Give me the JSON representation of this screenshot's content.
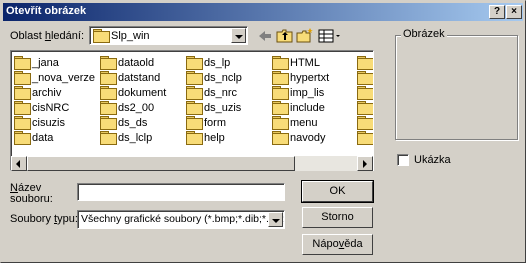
{
  "window": {
    "title": "Otevřít obrázek",
    "help_button": "?",
    "close_button": "×"
  },
  "lookin": {
    "label_prefix": "Oblast ",
    "label_underlined": "h",
    "label_suffix": "ledání:",
    "value": "Slp_win"
  },
  "toolbar": {
    "icons": [
      "back-icon",
      "up-folder-icon",
      "new-folder-icon",
      "view-menu-icon"
    ]
  },
  "files": {
    "columns": [
      [
        "_jana",
        "_nova_verze",
        "archiv",
        "cisNRC",
        "cisuzis",
        "data"
      ],
      [
        "dataold",
        "datstand",
        "dokument",
        "ds2_00",
        "ds_ds",
        "ds_lclp"
      ],
      [
        "ds_lp",
        "ds_nclp",
        "ds_nrc",
        "ds_uzis",
        "form",
        "help"
      ],
      [
        "HTML",
        "hypertxt",
        "imp_lis",
        "include",
        "menu",
        "navody"
      ],
      [
        "p",
        "p",
        "r",
        "r",
        "s",
        "t"
      ]
    ]
  },
  "filename": {
    "label_underlined": "N",
    "label_rest_line1": "ázev",
    "label_line2": "souboru:",
    "value": ""
  },
  "filetype": {
    "label_prefix": "Soubory ",
    "label_underlined": "t",
    "label_suffix": "ypu:",
    "value": "Všechny grafické soubory (*.bmp;*.dib;*.jpg;*"
  },
  "buttons": {
    "ok": "OK",
    "cancel": "Storno",
    "help": "Nápověda",
    "help_underlined": "v"
  },
  "preview": {
    "group_label": "Obrázek",
    "checkbox_label": "Ukázka",
    "checkbox_checked": false
  }
}
